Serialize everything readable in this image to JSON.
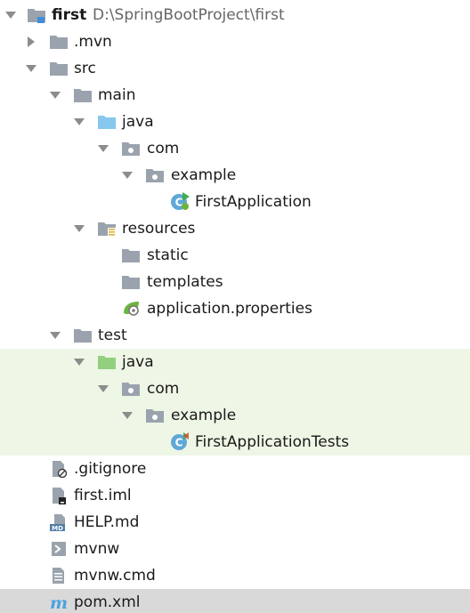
{
  "project": {
    "name": "first",
    "path": "D:\\SpringBootProject\\first"
  },
  "tree": {
    "mvn": ".mvn",
    "src": "src",
    "main": "main",
    "main_java": "java",
    "main_com": "com",
    "main_example": "example",
    "first_application": "FirstApplication",
    "resources": "resources",
    "static": "static",
    "templates": "templates",
    "application_properties": "application.properties",
    "test": "test",
    "test_java": "java",
    "test_com": "com",
    "test_example": "example",
    "first_application_tests": "FirstApplicationTests",
    "gitignore": ".gitignore",
    "first_iml": "first.iml",
    "help_md": "HELP.md",
    "mvnw": "mvnw",
    "mvnw_cmd": "mvnw.cmd",
    "pom_xml": "pom.xml"
  },
  "icon_badges": {
    "md": "MD",
    "maven": "m",
    "class": "C"
  },
  "colors": {
    "folder_gray": "#9aa3ad",
    "source_folder_blue": "#87c8ec",
    "test_folder_green": "#92cf7f",
    "test_row_bg": "#eef6e6",
    "selected_row_bg": "#d9d9d9",
    "spring_green": "#6db33f",
    "maven_blue": "#4aa3df"
  }
}
